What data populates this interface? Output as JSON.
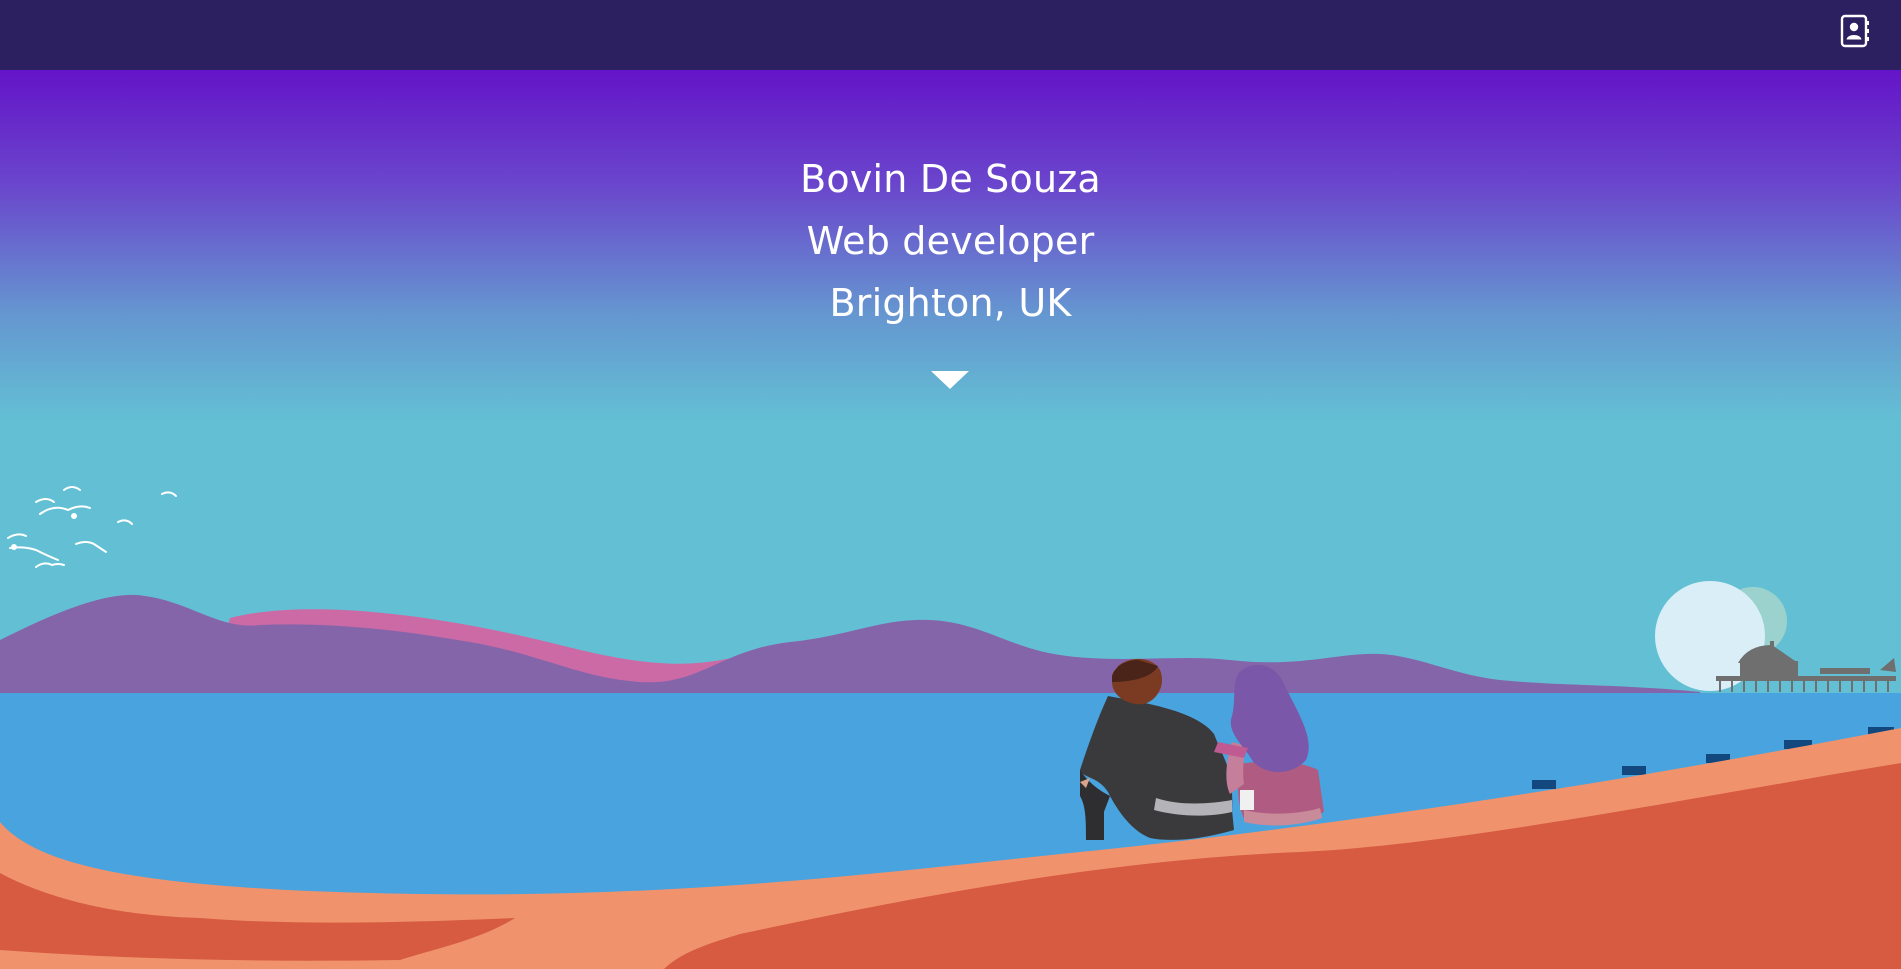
{
  "header": {
    "contact_icon": "contact-book-icon"
  },
  "hero": {
    "name": "Bovin De Souza",
    "role": "Web developer",
    "location": "Brighton, UK",
    "scroll_icon": "chevron-down-icon"
  },
  "colors": {
    "topbar": "#2c2060",
    "sky_top": "#6414c8",
    "sky_mid": "#6596d0",
    "sky_bottom": "#63c0d4",
    "sea": "#49a3de",
    "hills_purple": "#8565aa",
    "hills_pink": "#cc6aa6",
    "sand_light": "#f0936c",
    "sand_dark": "#d65b40",
    "moon": "#d9eef7"
  }
}
